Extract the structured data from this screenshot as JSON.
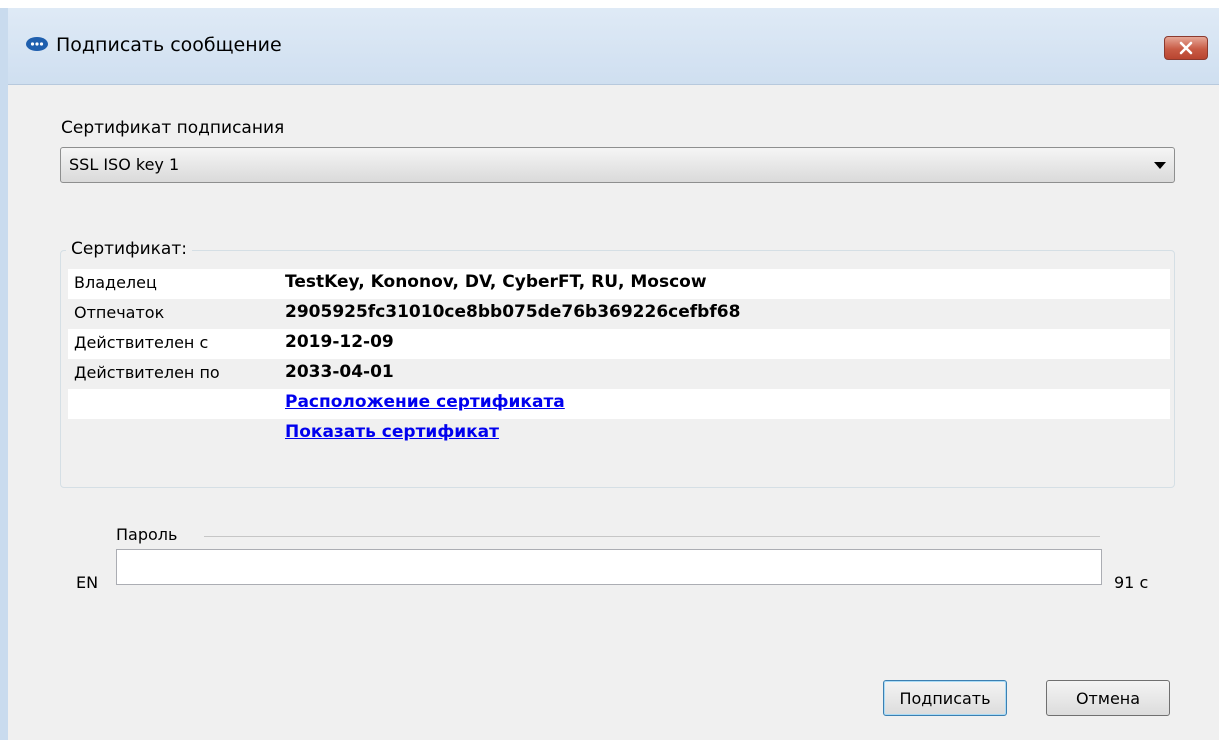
{
  "window": {
    "title": "Подписать сообщение",
    "app_icon": "chat-bubble-icon",
    "close_icon": "close-icon"
  },
  "signing": {
    "label": "Сертификат подписания",
    "selected_certificate": "SSL ISO key 1"
  },
  "certificate": {
    "legend": "Сертификат:",
    "rows": [
      {
        "key": "Владелец",
        "value": "TestKey, Kononov, DV, CyberFT, RU, Moscow"
      },
      {
        "key": "Отпечаток",
        "value": "2905925fc31010ce8bb075de76b369226cefbf68"
      },
      {
        "key": "Действителен с",
        "value": "2019-12-09"
      },
      {
        "key": "Действителен по",
        "value": "2033-04-01"
      }
    ],
    "links": {
      "location": "Расположение сертификата",
      "show": "Показать сертификат"
    }
  },
  "password": {
    "legend": "Пароль",
    "layout_indicator": "EN",
    "value": "",
    "timer": "91 с"
  },
  "buttons": {
    "sign": "Подписать",
    "cancel": "Отмена"
  },
  "colors": {
    "link": "#0000ee",
    "close_button": "#c85b45",
    "titlebar": "#dfeaf6"
  }
}
